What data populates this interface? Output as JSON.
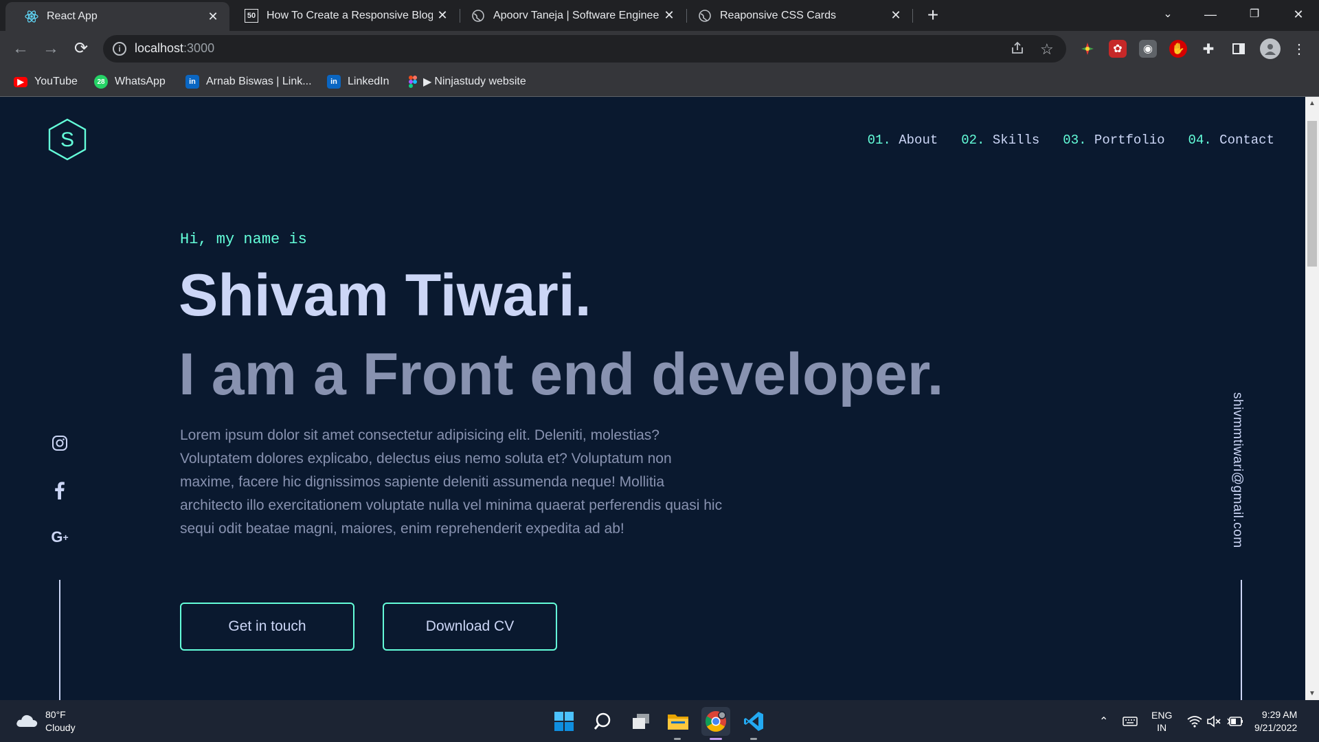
{
  "browser": {
    "tabs": [
      {
        "title": "React App",
        "active": true
      },
      {
        "title": "How To Create a Responsive Blog",
        "active": false
      },
      {
        "title": "Apoorv Taneja | Software Engineer",
        "active": false
      },
      {
        "title": "Reaponsive CSS Cards",
        "active": false
      }
    ],
    "url_host": "localhost",
    "url_port": ":3000",
    "bookmarks": [
      "YouTube",
      "WhatsApp",
      "Arnab Biswas | Link...",
      "LinkedIn",
      "Ninjastudy website"
    ],
    "whatsapp_badge": "28"
  },
  "site": {
    "logo_letter": "S",
    "nav": [
      {
        "num": "01.",
        "label": "About"
      },
      {
        "num": "02.",
        "label": "Skills"
      },
      {
        "num": "03.",
        "label": "Portfolio"
      },
      {
        "num": "04.",
        "label": "Contact"
      }
    ],
    "hero": {
      "greeting": "Hi, my name is",
      "name": "Shivam Tiwari.",
      "role": "I am a Front end developer.",
      "description": "Lorem ipsum dolor sit amet consectetur adipisicing elit. Deleniti, molestias? Voluptatem dolores explicabo, delectus eius nemo soluta et? Voluptatum non maxime, facere hic dignissimos sapiente deleniti assumenda neque! Mollitia architecto illo exercitationem voluptate nulla vel minima quaerat perferendis quasi hic sequi odit beatae magni, maiores, enim reprehenderit expedita ad ab!",
      "cta_primary": "Get in touch",
      "cta_secondary": "Download CV"
    },
    "social_icons": [
      "instagram-icon",
      "facebook-icon",
      "google-plus-icon"
    ],
    "email": "shivmmtiwari@gmail.com",
    "colors": {
      "background": "#0a192f",
      "accent": "#64ffda",
      "heading": "#ccd6f6",
      "muted": "#8892b0"
    }
  },
  "taskbar": {
    "weather_temp": "80°F",
    "weather_desc": "Cloudy",
    "lang_top": "ENG",
    "lang_bottom": "IN",
    "time": "9:29 AM",
    "date": "9/21/2022"
  }
}
